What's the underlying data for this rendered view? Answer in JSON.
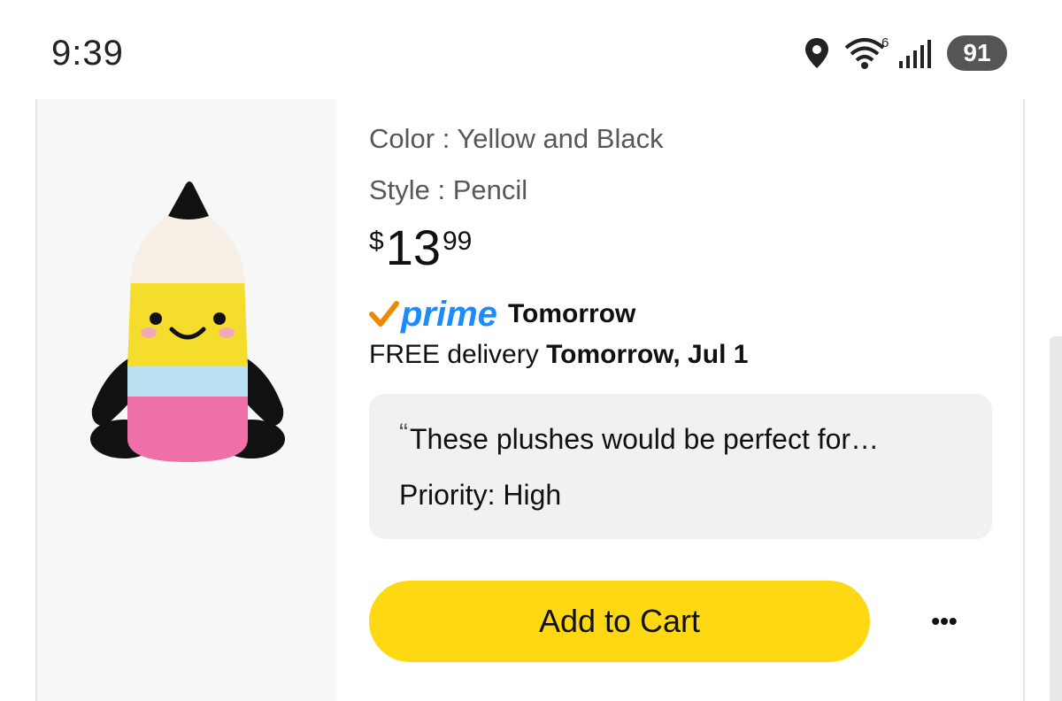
{
  "status_bar": {
    "time": "9:39",
    "wifi_badge": "6",
    "battery": "91",
    "icons": [
      "location-icon",
      "wifi-icon",
      "signal-icon",
      "battery-icon"
    ]
  },
  "product": {
    "image_alt": "pencil plush toy",
    "color_line": "Color : Yellow and Black",
    "style_line": "Style : Pencil",
    "price": {
      "symbol": "$",
      "whole": "13",
      "fraction": "99"
    },
    "prime": {
      "word": "prime",
      "day": "Tomorrow"
    },
    "delivery": {
      "prefix": "FREE delivery ",
      "date": "Tomorrow, Jul 1"
    },
    "note": {
      "quote": "These plushes would be perfect for…",
      "priority": "Priority: High"
    },
    "add_to_cart": "Add to Cart",
    "more": "•••"
  },
  "colors": {
    "button_yellow": "#ffd814",
    "prime_blue": "#1a8cff",
    "prime_check": "#f08804",
    "note_bg": "#f0f2f2"
  }
}
